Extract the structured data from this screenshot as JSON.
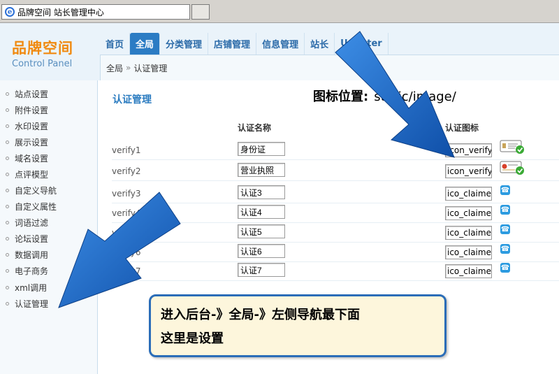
{
  "browser": {
    "tab_title": "品牌空间 站长管理中心"
  },
  "logo": {
    "main": "品牌空间",
    "sub": "Control Panel"
  },
  "nav": {
    "items": [
      {
        "label": "首页"
      },
      {
        "label": "全局"
      },
      {
        "label": "分类管理"
      },
      {
        "label": "店铺管理"
      },
      {
        "label": "信息管理"
      },
      {
        "label": "站长"
      },
      {
        "label": "UCenter"
      }
    ],
    "active_index": 1
  },
  "breadcrumb": {
    "root": "全局",
    "separator": "»",
    "current": "认证管理"
  },
  "sidebar": {
    "items": [
      {
        "label": "站点设置"
      },
      {
        "label": "附件设置"
      },
      {
        "label": "水印设置"
      },
      {
        "label": "展示设置"
      },
      {
        "label": "域名设置"
      },
      {
        "label": "点评模型"
      },
      {
        "label": "自定义导航"
      },
      {
        "label": "自定义属性"
      },
      {
        "label": "词语过滤"
      },
      {
        "label": "论坛设置"
      },
      {
        "label": "数据调用"
      },
      {
        "label": "电子商务"
      },
      {
        "label": "xml调用"
      },
      {
        "label": "认证管理"
      }
    ],
    "active_index": 13
  },
  "main": {
    "title": "认证管理",
    "icon_position_label": "图标位置:",
    "icon_position_value": "static/image/",
    "columns": {
      "name": "认证名称",
      "icon": "认证图标"
    },
    "rows": [
      {
        "key": "verify1",
        "name": "身份证",
        "icon": "icon_verify",
        "badge": "id-card-verified-icon"
      },
      {
        "key": "verify2",
        "name": "营业执照",
        "icon": "icon_verify",
        "badge": "license-verified-icon"
      },
      {
        "key": "verify3",
        "name": "认证3",
        "icon": "ico_claime.",
        "badge": "claim-icon"
      },
      {
        "key": "verify4",
        "name": "认证4",
        "icon": "ico_claime.",
        "badge": "claim-icon"
      },
      {
        "key": "verify5",
        "name": "认证5",
        "icon": "ico_claime.",
        "badge": "claim-icon"
      },
      {
        "key": "verify6",
        "name": "认证6",
        "icon": "ico_claime.",
        "badge": "claim-icon"
      },
      {
        "key": "verify7",
        "name": "认证7",
        "icon": "ico_claime.",
        "badge": "claim-icon"
      }
    ]
  },
  "callout": {
    "line1": "进入后台-》全局-》左侧导航最下面",
    "line2": "这里是设置"
  },
  "colors": {
    "accent": "#2c7cc4",
    "arrow": "#1a63c8",
    "logo": "#f08a10",
    "callout_bg": "#fdf6dc"
  }
}
